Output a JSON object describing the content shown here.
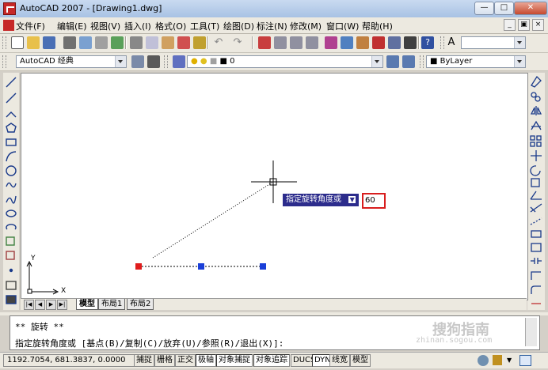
{
  "window": {
    "title": "AutoCAD 2007 - [Drawing1.dwg]"
  },
  "menu": [
    "文件(F)",
    "编辑(E)",
    "视图(V)",
    "插入(I)",
    "格式(O)",
    "工具(T)",
    "绘图(D)",
    "标注(N)",
    "修改(M)",
    "窗口(W)",
    "帮助(H)"
  ],
  "workspace": {
    "value": "AutoCAD 经典"
  },
  "layer": {
    "value": "0"
  },
  "properties": {
    "color_value": "ByLayer"
  },
  "layout_tabs": [
    "模型",
    "布局1",
    "布局2"
  ],
  "dynamic_input": {
    "prompt": "指定旋转角度或",
    "value": "60"
  },
  "ucs": {
    "x_label": "X",
    "y_label": "Y"
  },
  "command": {
    "line1": "** 旋转 **",
    "line2": "指定旋转角度或 [基点(B)/复制(C)/放弃(U)/参照(R)/退出(X)]:"
  },
  "status": {
    "coords": "1192.7054, 681.3837, 0.0000",
    "buttons": [
      "捕捉",
      "栅格",
      "正交",
      "极轴",
      "对象捕捉",
      "对象追踪",
      "DUCS",
      "DYN",
      "线宽",
      "模型"
    ]
  },
  "watermark": "搜狗指南",
  "watermark_url": "zhinan.sogou.com",
  "colors": {
    "grip_selected": "#e01c1c",
    "grip_unselected": "#1a3fd8",
    "tooltip_bg": "#2c2c8c"
  }
}
